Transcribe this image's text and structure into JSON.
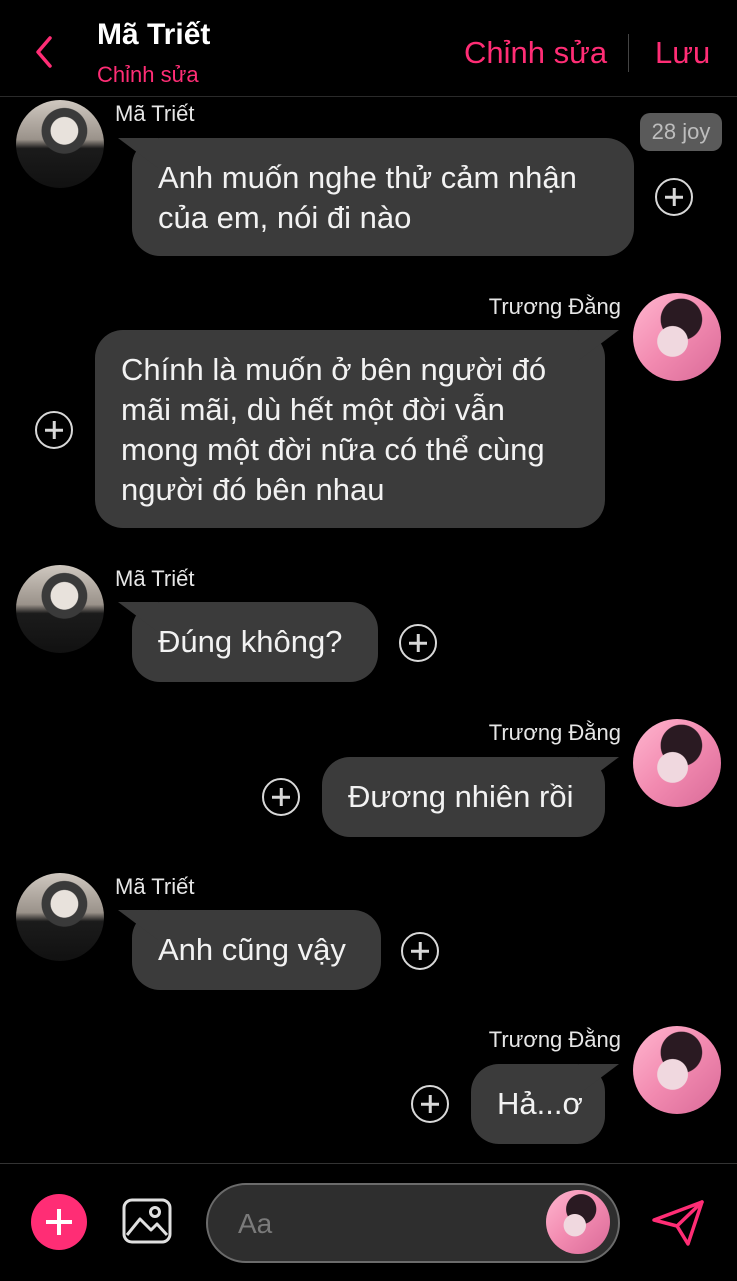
{
  "header": {
    "title": "Mã Triết",
    "subtitle": "Chỉnh sửa",
    "edit_label": "Chỉnh sửa",
    "save_label": "Lưu"
  },
  "badge": "28 joy",
  "messages": [
    {
      "sender": "Mã Triết",
      "text": "Anh muốn nghe thử cảm nhận của em, nói đi nào"
    },
    {
      "sender": "Trương Đằng",
      "text": "Chính là muốn ở bên người đó mãi mãi, dù hết một đời vẫn mong một đời nữa có thể cùng người đó bên nhau"
    },
    {
      "sender": "Mã Triết",
      "text": "Đúng không?"
    },
    {
      "sender": "Trương Đằng",
      "text": "Đương nhiên rồi"
    },
    {
      "sender": "Mã Triết",
      "text": "Anh cũng vậy"
    },
    {
      "sender": "Trương Đằng",
      "text": "Hả...ơ"
    }
  ],
  "composer": {
    "placeholder": "Aa"
  },
  "colors": {
    "accent": "#ff2d75",
    "bubble": "#3b3b3b",
    "background": "#000000"
  }
}
